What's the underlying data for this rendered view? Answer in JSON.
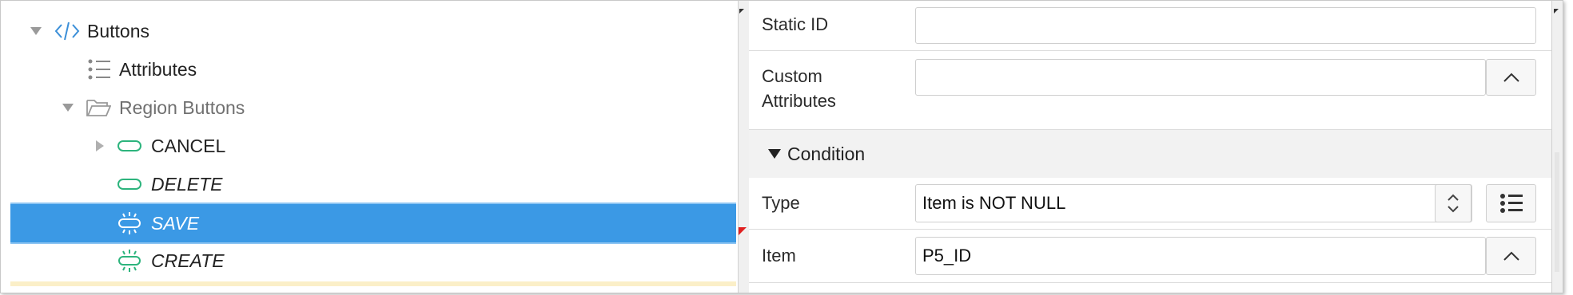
{
  "tree": {
    "items": [
      {
        "label": "Buttons",
        "icon": "code-brackets-icon",
        "expanded": true
      },
      {
        "label": "Attributes",
        "icon": "list-icon"
      },
      {
        "label": "Region Buttons",
        "icon": "folder-open-icon",
        "expanded": true
      },
      {
        "label": "CANCEL",
        "icon": "button-pill-icon",
        "collapsed": true
      },
      {
        "label": "DELETE",
        "icon": "button-pill-icon"
      },
      {
        "label": "SAVE",
        "icon": "button-dynamic-icon",
        "selected": true
      },
      {
        "label": "CREATE",
        "icon": "button-dynamic-icon"
      }
    ]
  },
  "properties": {
    "static_id": {
      "label": "Static ID",
      "value": ""
    },
    "custom_attributes": {
      "label_line1": "Custom",
      "label_line2": "Attributes",
      "value": ""
    },
    "condition": {
      "title": "Condition"
    },
    "type": {
      "label": "Type",
      "value": "Item is NOT NULL"
    },
    "item": {
      "label": "Item",
      "value": "P5_ID"
    }
  },
  "colors": {
    "selection": "#3b99e5",
    "button_icon": "#2db47d",
    "code_icon": "#3b8fd8",
    "required_marker": "#e02020"
  }
}
